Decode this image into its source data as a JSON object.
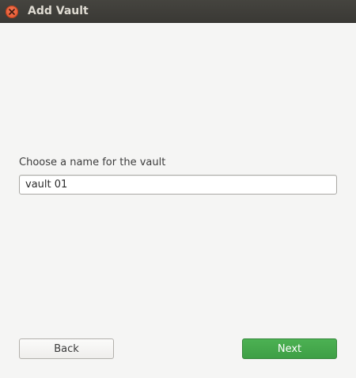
{
  "window": {
    "title": "Add Vault"
  },
  "form": {
    "label": "Choose a name for the vault",
    "input_value": "vault 01"
  },
  "buttons": {
    "back_label": "Back",
    "next_label": "Next"
  },
  "colors": {
    "titlebar": "#3e3d39",
    "close_button": "#e9602f",
    "next_button": "#45a84b",
    "background": "#f5f5f4"
  },
  "icons": {
    "close": "close-icon"
  }
}
